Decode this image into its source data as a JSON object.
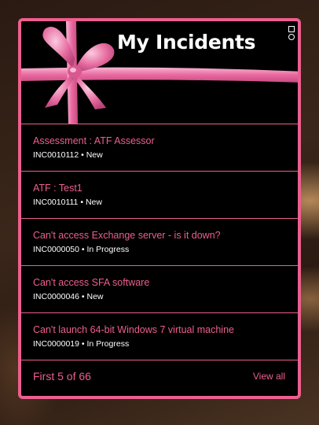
{
  "widget": {
    "title": "My Incidents",
    "menu_icon": "widget-options-icon"
  },
  "incidents": [
    {
      "title": "Assessment : ATF Assessor",
      "number": "INC0010112",
      "separator": "•",
      "state": "New"
    },
    {
      "title": "ATF : Test1",
      "number": "INC0010111",
      "separator": "•",
      "state": "New"
    },
    {
      "title": "Can't access Exchange server - is it down?",
      "number": "INC0000050",
      "separator": "•",
      "state": "In Progress"
    },
    {
      "title": "Can't access SFA software",
      "number": "INC0000046",
      "separator": "•",
      "state": "New"
    },
    {
      "title": "Can't launch 64-bit Windows 7 virtual machine",
      "number": "INC0000019",
      "separator": "•",
      "state": "In Progress"
    }
  ],
  "footer": {
    "count_label": "First 5 of 66",
    "view_all_label": "View all"
  },
  "colors": {
    "accent": "#ec5f8f",
    "background": "#000000",
    "text": "#ffffff"
  }
}
